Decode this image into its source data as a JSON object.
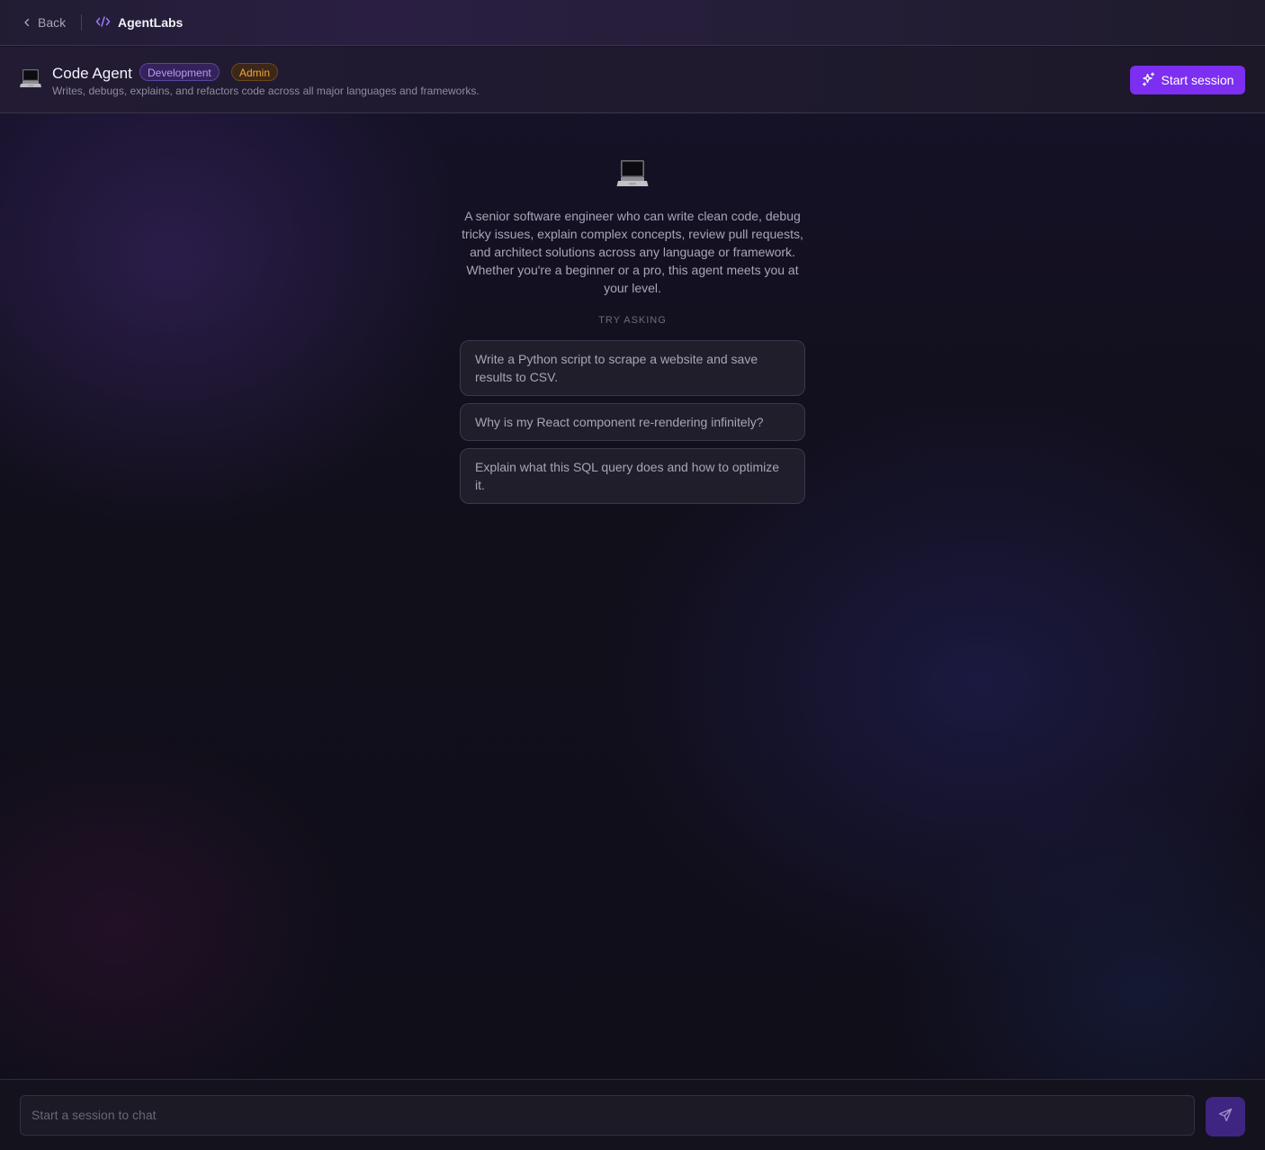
{
  "nav": {
    "back_label": "Back",
    "brand": "AgentLabs"
  },
  "agent": {
    "emoji": "laptop-icon",
    "name": "Code Agent",
    "badges": [
      "Development",
      "Admin"
    ],
    "description": "Writes, debugs, explains, and refactors code across all major languages and frameworks.",
    "start_label": "Start session"
  },
  "main": {
    "intro": "A senior software engineer who can write clean code, debug tricky issues, explain complex concepts, review pull requests, and architect solutions across any language or framework. Whether you're a beginner or a pro, this agent meets you at your level.",
    "try_label": "TRY ASKING",
    "suggestions": [
      "Write a Python script to scrape a website and save results to CSV.",
      "Why is my React component re-rendering infinitely?",
      "Explain what this SQL query does and how to optimize it."
    ]
  },
  "composer": {
    "placeholder": "Start a session to chat"
  },
  "colors": {
    "accent": "#7c2ff0",
    "development_badge": "#b69cf7",
    "admin_badge": "#f0a53a",
    "send_button": "#3f2582"
  }
}
